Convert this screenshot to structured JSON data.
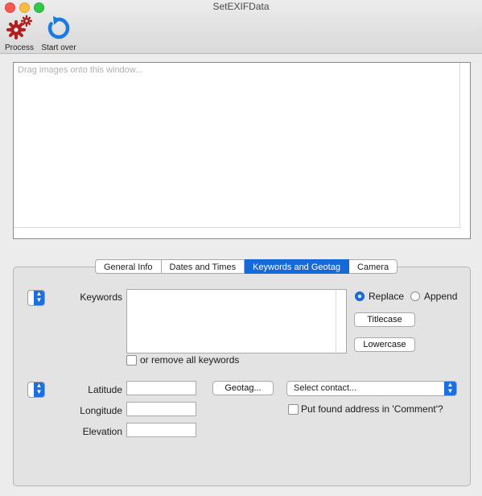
{
  "window": {
    "title": "SetEXIFData"
  },
  "toolbar": {
    "process_label": "Process",
    "start_over_label": "Start over"
  },
  "drop_area": {
    "placeholder": "Drag images onto this window..."
  },
  "tabs": [
    {
      "label": "General Info",
      "active": false
    },
    {
      "label": "Dates and Times",
      "active": false
    },
    {
      "label": "Keywords and Geotag",
      "active": true
    },
    {
      "label": "Camera",
      "active": false
    }
  ],
  "keywords": {
    "label": "Keywords",
    "value": "",
    "mode_options": [
      {
        "label": "Replace",
        "selected": true
      },
      {
        "label": "Append",
        "selected": false
      }
    ],
    "titlecase_label": "Titlecase",
    "lowercase_label": "Lowercase",
    "remove_all_label": "or remove all keywords",
    "remove_all_checked": false
  },
  "geotag": {
    "latitude_label": "Latitude",
    "longitude_label": "Longitude",
    "elevation_label": "Elevation",
    "latitude_value": "",
    "longitude_value": "",
    "elevation_value": "",
    "geotag_button_label": "Geotag...",
    "contact_select_value": "Select contact...",
    "put_address_label": "Put found address in 'Comment'?",
    "put_address_checked": false
  },
  "colors": {
    "accent": "#1b6fe0",
    "gear_icon": "#b11f1f",
    "refresh_icon": "#1a7be0"
  },
  "icons": [
    "gear-icon",
    "refresh-icon",
    "chevron-updown-icon"
  ]
}
